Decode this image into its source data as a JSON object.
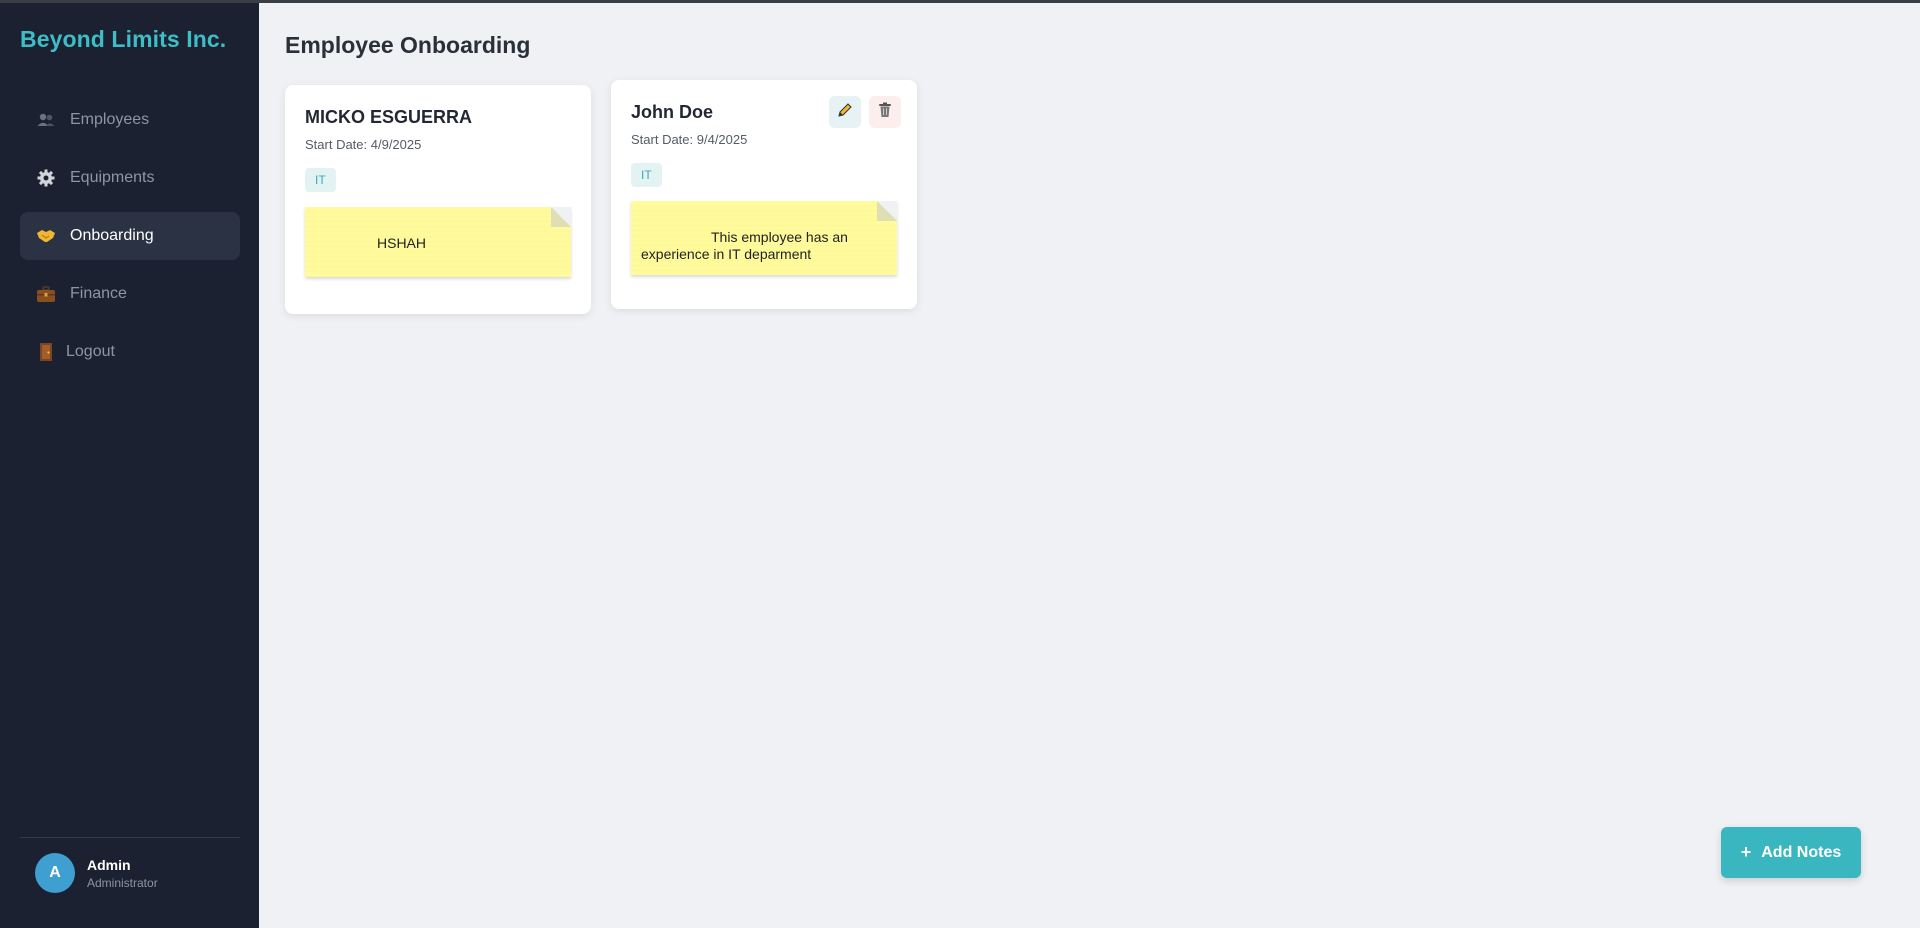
{
  "sidebar": {
    "brand": "Beyond Limits Inc.",
    "items": [
      {
        "label": "Employees",
        "icon": "people-icon"
      },
      {
        "label": "Equipments",
        "icon": "gear-icon"
      },
      {
        "label": "Onboarding",
        "icon": "handshake-icon",
        "active": true
      },
      {
        "label": "Finance",
        "icon": "briefcase-icon"
      },
      {
        "label": "Logout",
        "icon": "door-icon"
      }
    ],
    "user": {
      "initial": "A",
      "name": "Admin",
      "role": "Administrator"
    }
  },
  "main": {
    "title": "Employee Onboarding",
    "cards": [
      {
        "name": "MICKO ESGUERRA",
        "start_date": "Start Date: 4/9/2025",
        "tag": "IT",
        "note": "HSHAH"
      },
      {
        "name": "John Doe",
        "start_date": "Start Date: 9/4/2025",
        "tag": "IT",
        "note": "This employee has an experience in IT deparment"
      }
    ],
    "add_button": {
      "label": "Add Notes",
      "icon": "+"
    }
  },
  "colors": {
    "sidebar_bg": "#1b2130",
    "brand": "#3dbdc6",
    "accent": "#3ab6c0",
    "note": "#fffb9c",
    "page_bg": "#eff1f5"
  }
}
